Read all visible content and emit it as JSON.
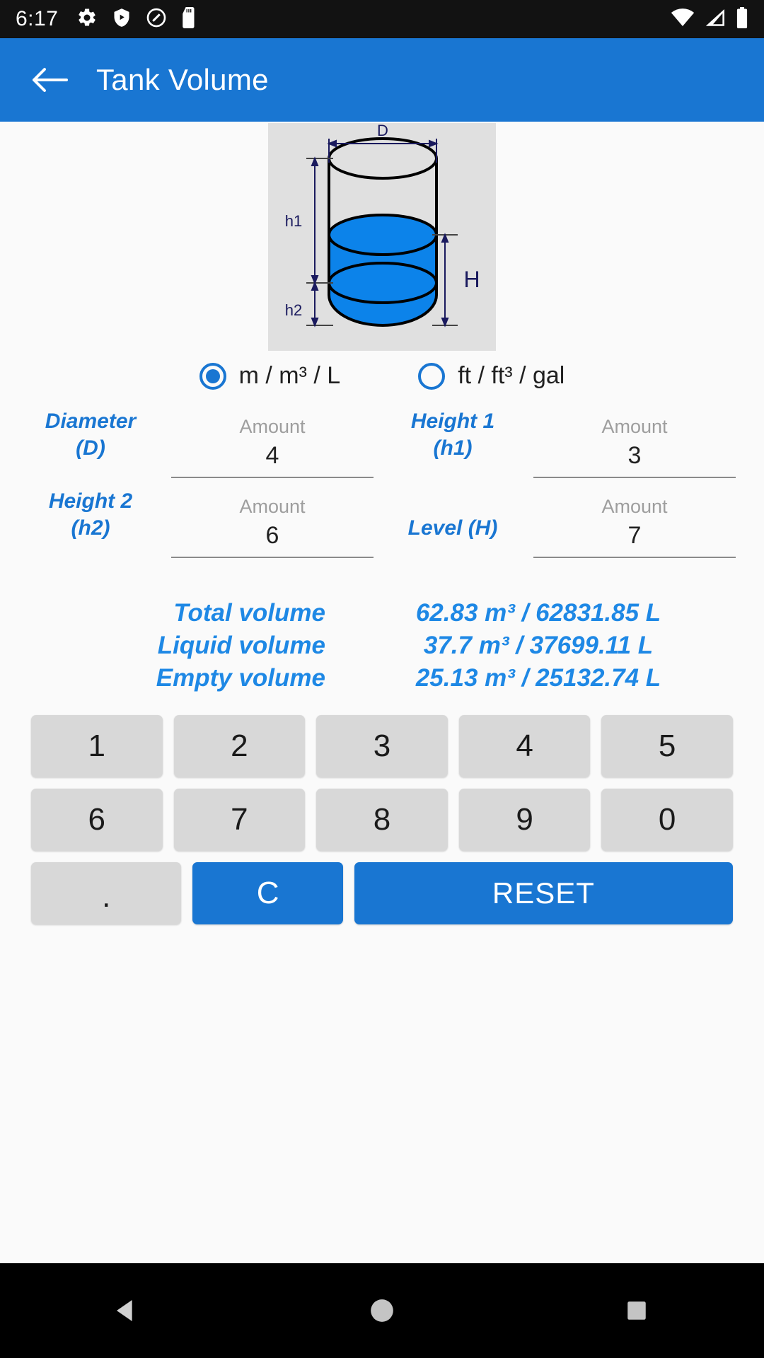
{
  "statusbar": {
    "time": "6:17",
    "left_icons": [
      "gear-icon",
      "shield-play-icon",
      "do-not-disturb-icon",
      "sd-card-icon"
    ],
    "right_icons": [
      "wifi-icon",
      "cellular-signal-icon",
      "battery-icon"
    ]
  },
  "appbar": {
    "back_icon": "back-arrow-icon",
    "title": "Tank Volume"
  },
  "diagram": {
    "label_d": "D",
    "label_h1": "h1",
    "label_h2": "h2",
    "label_h": "H",
    "liquid_color": "#0c83ea",
    "background": "#e0e0e0",
    "outline_color": "#000000",
    "dimension_color": "#1a1a5e"
  },
  "units": {
    "options": [
      {
        "label": "m / m³ / L",
        "selected": true
      },
      {
        "label": "ft / ft³ / gal",
        "selected": false
      }
    ]
  },
  "inputs": [
    {
      "label": "Diameter\n(D)",
      "label_line1": "Diameter",
      "label_line2": "(D)",
      "placeholder": "Amount",
      "value": "4"
    },
    {
      "label": "Height 1\n(h1)",
      "label_line1": "Height 1",
      "label_line2": "(h1)",
      "placeholder": "Amount",
      "value": "3"
    },
    {
      "label": "Height 2\n(h2)",
      "label_line1": "Height 2",
      "label_line2": "(h2)",
      "placeholder": "Amount",
      "value": "6"
    },
    {
      "label": "Level (H)",
      "label_line1": "Level (H)",
      "label_line2": "",
      "placeholder": "Amount",
      "value": "7"
    }
  ],
  "results": [
    {
      "name": "Total volume",
      "value": "62.83 m³ / 62831.85 L"
    },
    {
      "name": "Liquid volume",
      "value": "37.7 m³ / 37699.11 L"
    },
    {
      "name": "Empty volume",
      "value": "25.13 m³ / 25132.74 L"
    }
  ],
  "keypad": {
    "row1": [
      "1",
      "2",
      "3",
      "4",
      "5"
    ],
    "row2": [
      "6",
      "7",
      "8",
      "9",
      "0"
    ],
    "dot": ".",
    "clear": "C",
    "reset": "RESET"
  },
  "navbar": {
    "back": "nav-back-icon",
    "home": "nav-home-icon",
    "recents": "nav-recents-icon"
  },
  "colors": {
    "accent": "#1976d2",
    "accent_text": "#1e88e5",
    "page_bg": "#fafafa",
    "key_bg": "#d8d8d8"
  }
}
